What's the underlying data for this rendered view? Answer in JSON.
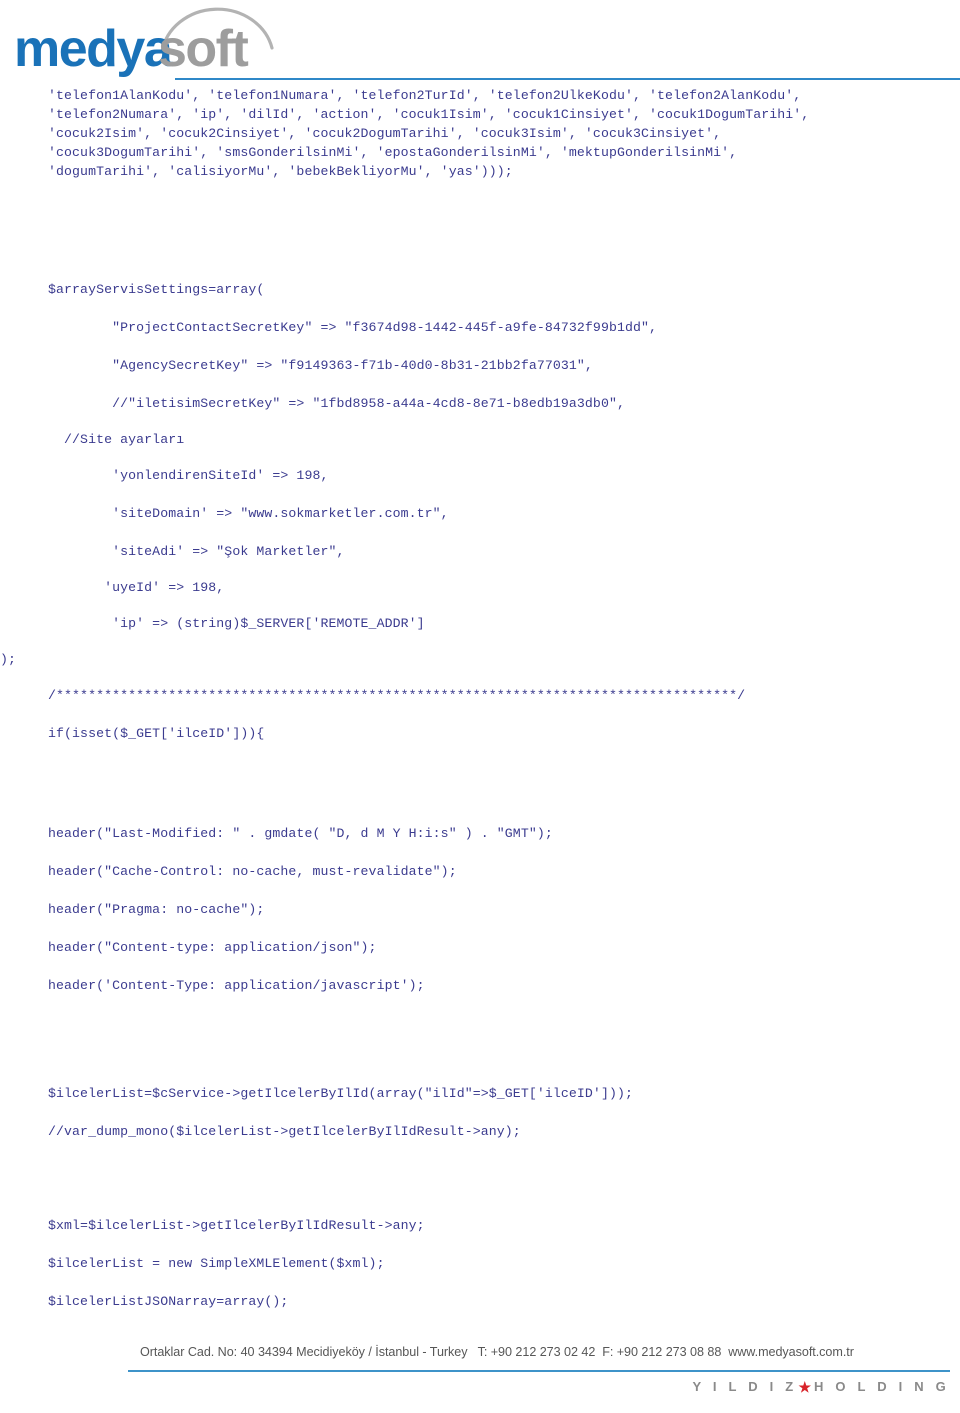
{
  "header": {
    "logo": {
      "text_primary": "medya",
      "text_secondary": "soft",
      "primary_color": "#1a72b8",
      "secondary_color": "#9d9d9d",
      "arc_color": "#b3b3b3"
    },
    "rule_color": "#2f88c8"
  },
  "code": {
    "text_color": "#3b3b8f",
    "block1": [
      "'telefon1AlanKodu', 'telefon1Numara', 'telefon2TurId', 'telefon2UlkeKodu', 'telefon2AlanKodu',",
      "'telefon2Numara', 'ip', 'dilId', 'action', 'cocuk1Isim', 'cocuk1Cinsiyet', 'cocuk1DogumTarihi',",
      "'cocuk2Isim', 'cocuk2Cinsiyet', 'cocuk2DogumTarihi', 'cocuk3Isim', 'cocuk3Cinsiyet',",
      "'cocuk3DogumTarihi', 'smsGonderilsinMi', 'epostaGonderilsinMi', 'mektupGonderilsinMi',",
      "'dogumTarihi', 'calisiyorMu', 'bebekBekliyorMu', 'yas')));"
    ],
    "array_open": "$arrayServisSettings=array(",
    "keys": [
      "        \"ProjectContactSecretKey\" => \"f3674d98-1442-445f-a9fe-84732f99b1dd\",",
      "        \"AgencySecretKey\" => \"f9149363-f71b-40d0-8b31-21bb2fa77031\",",
      "        //\"iletisimSecretKey\" => \"1fbd8958-a44a-4cd8-8e71-b8edb19a3db0\","
    ],
    "site_comment": "  //Site ayarları",
    "site_settings": [
      "        'yonlendirenSiteId' => 198,",
      "        'siteDomain' => \"www.sokmarketler.com.tr\",",
      "        'siteAdi' => \"Şok Marketler\",",
      "       'uyeId' => 198,",
      "        'ip' => (string)$_SERVER['REMOTE_ADDR']"
    ],
    "array_close": ");",
    "separator": "/*************************************************************************************/",
    "if_line": "if(isset($_GET['ilceID'])){",
    "headers": [
      "header(\"Last-Modified: \" . gmdate( \"D, d M Y H:i:s\" ) . \"GMT\");",
      "header(\"Cache-Control: no-cache, must-revalidate\");",
      "header(\"Pragma: no-cache\");",
      "header(\"Content-type: application/json\");",
      "header('Content-Type: application/javascript');"
    ],
    "service_calls": [
      "$ilcelerList=$cService->getIlcelerByIlId(array(\"ilId\"=>$_GET['ilceID']));",
      "//var_dump_mono($ilcelerList->getIlcelerByIlIdResult->any);"
    ],
    "xml_calls": [
      "$xml=$ilcelerList->getIlcelerByIlIdResult->any;",
      "$ilcelerList = new SimpleXMLElement($xml);",
      "$ilcelerListJSONarray=array();"
    ]
  },
  "footer": {
    "address": "Ortaklar Cad. No: 40 34394 Mecidiyeköy / İstanbul - Turkey   T: +90 212 273 02 42  F: +90 212 273 08 88  www.medyasoft.com.tr",
    "rule_color": "#3e93c9",
    "brand_left": "Y I L D I Z",
    "brand_star": "★",
    "brand_right": "H O L D I N G",
    "brand_color": "#8a8a8a",
    "star_color": "#d8232a"
  }
}
